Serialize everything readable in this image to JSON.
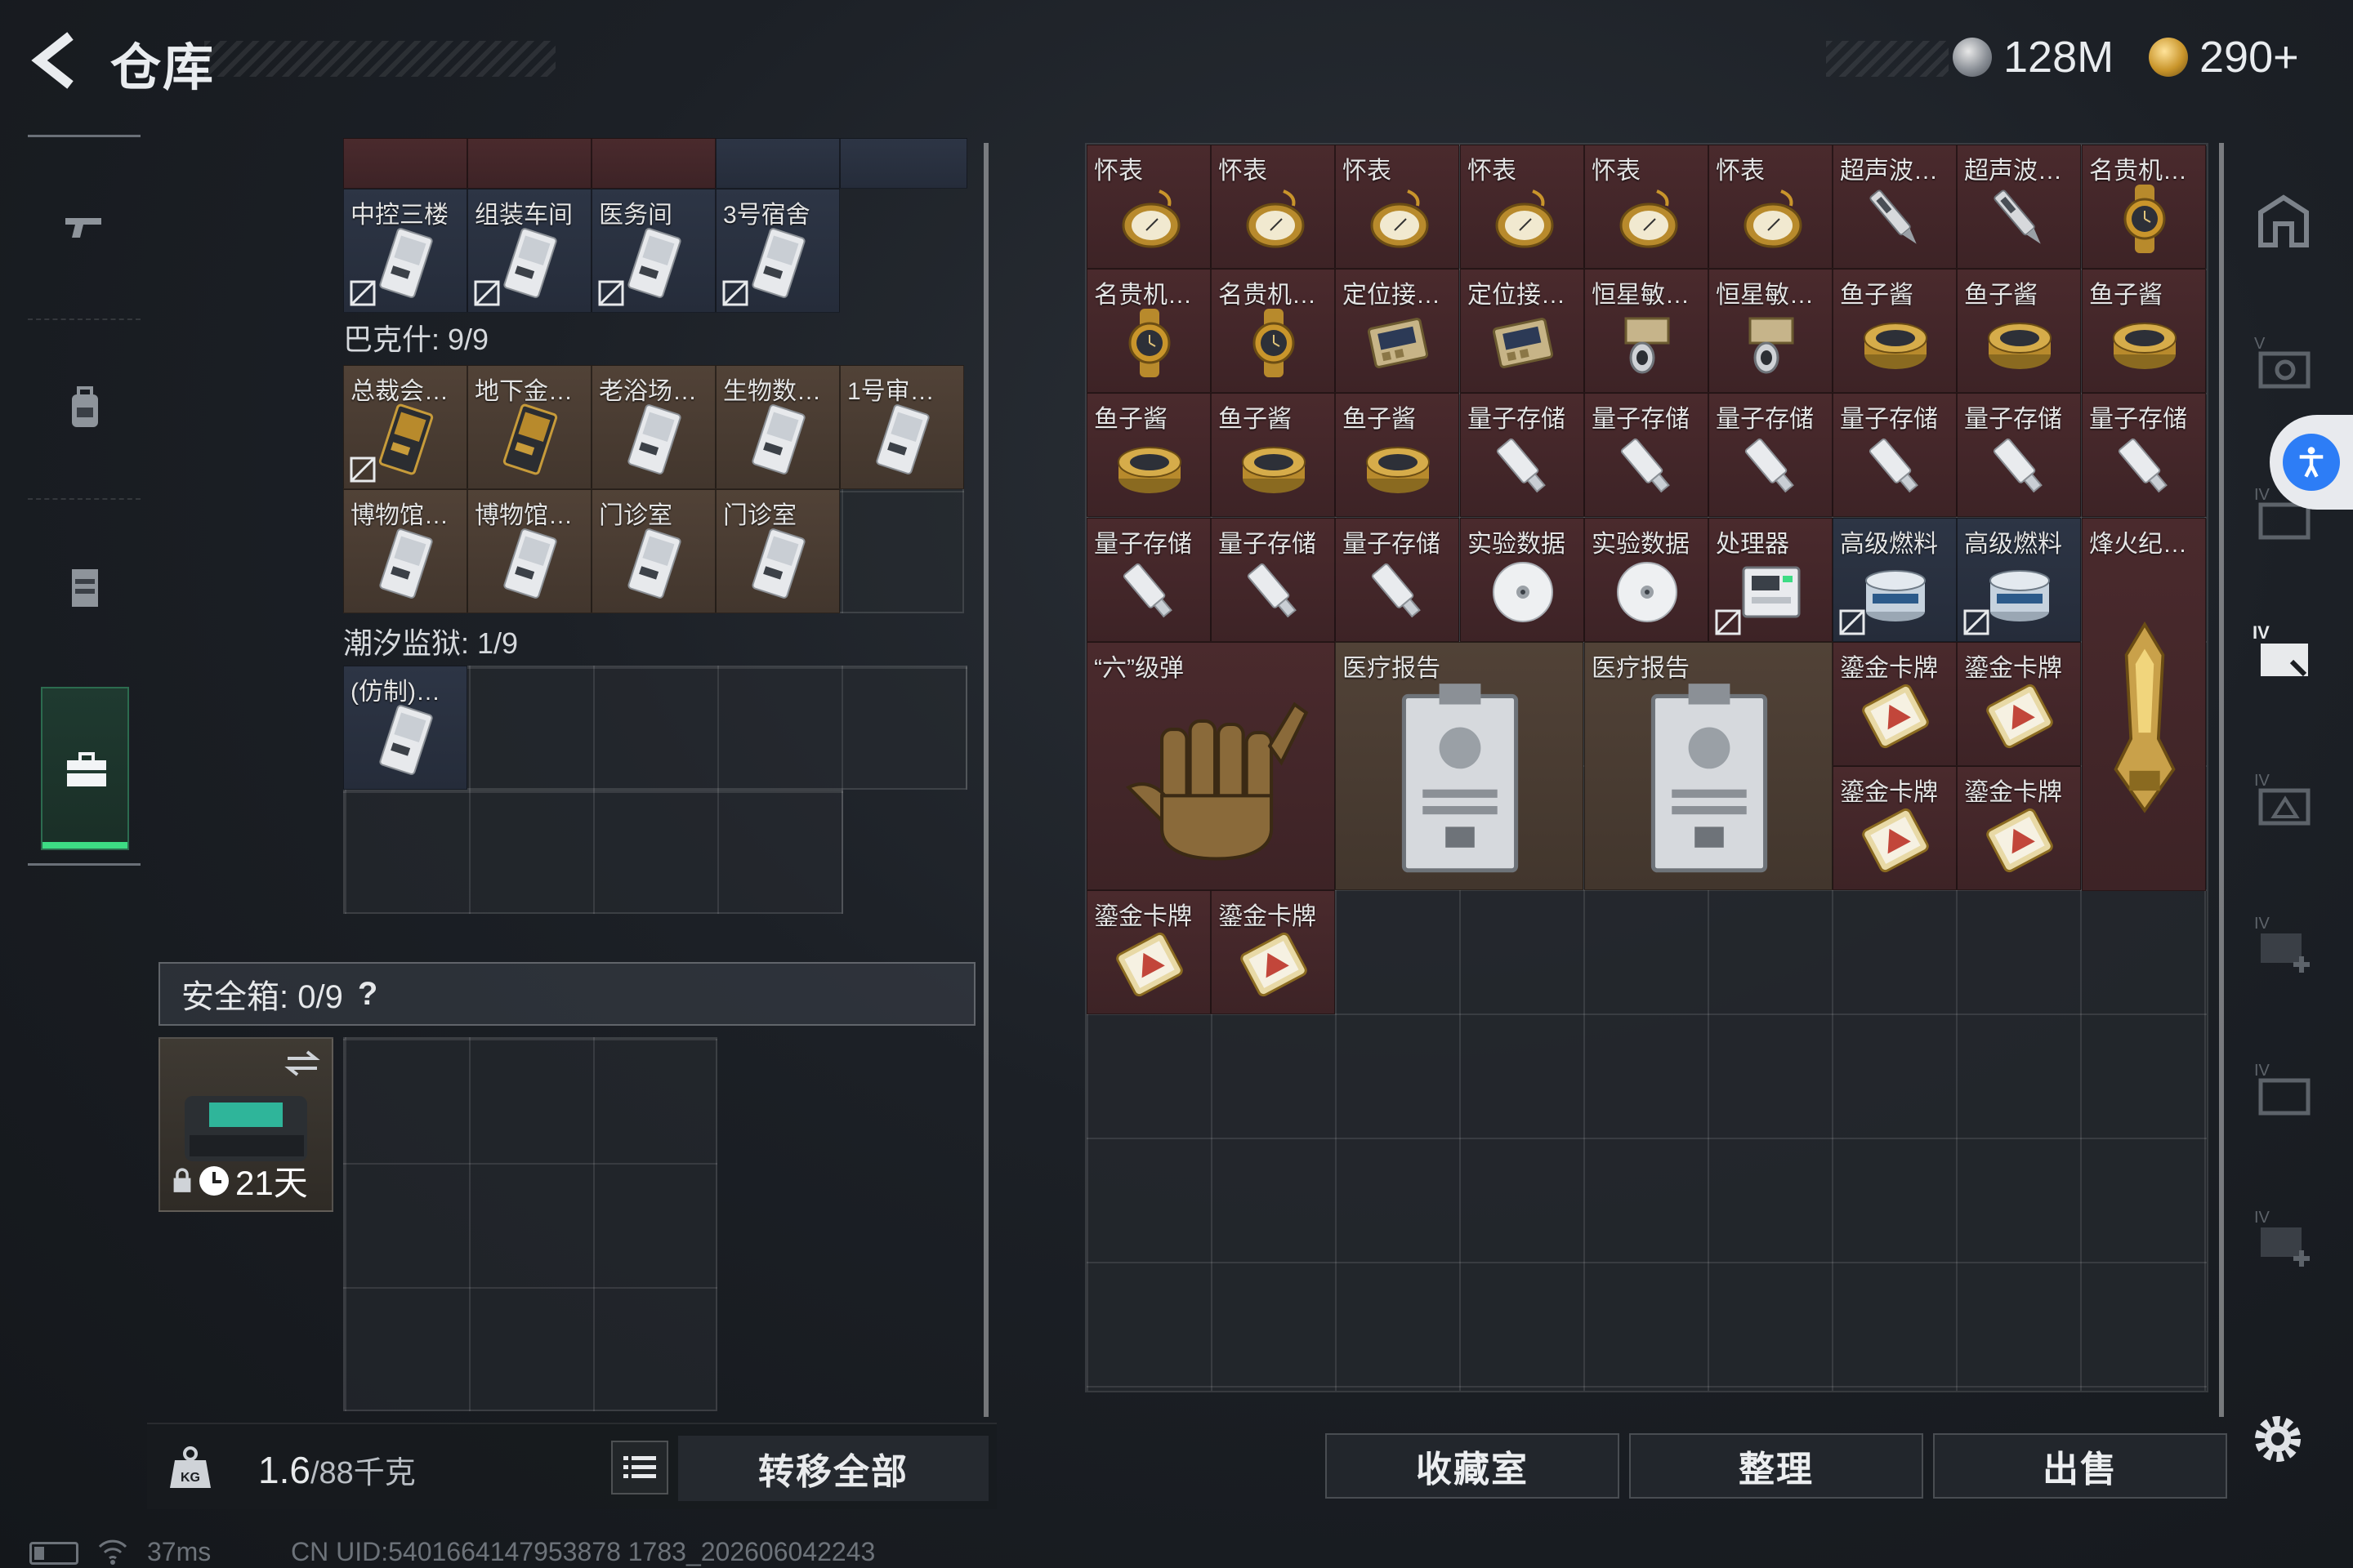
{
  "header": {
    "title": "仓库",
    "currency_1": "128M",
    "currency_2": "290+"
  },
  "left_nav": {
    "items": [
      "gun-icon",
      "backpack-icon",
      "vest-icon",
      "case-icon"
    ],
    "active": 3
  },
  "left_panel": {
    "top_row_labels": [
      "中控三楼",
      "组装车间",
      "医务间",
      "3号宿舍"
    ],
    "section_bakeshi": "巴克什: 9/9",
    "bakeshi_items": [
      "总裁会…",
      "地下金…",
      "老浴场…",
      "生物数…",
      "1号审…",
      "博物馆…",
      "博物馆…",
      "门诊室",
      "门诊室"
    ],
    "section_chaoxi": "潮汐监狱: 1/9",
    "chaoxi_items": [
      "(仿制)…"
    ],
    "safebox_label": "安全箱: 0/9",
    "safebox_help": "?",
    "safebox_days": "21天"
  },
  "bottom_left": {
    "weight_value": "1.6",
    "weight_total": "/88千克",
    "transfer_all": "转移全部"
  },
  "right_panel": {
    "row1": [
      "怀表",
      "怀表",
      "怀表",
      "怀表",
      "怀表",
      "怀表",
      "超声波…",
      "超声波…",
      "名贵机…"
    ],
    "row2": [
      "名贵机…",
      "名贵机…",
      "定位接…",
      "定位接…",
      "恒星敏…",
      "恒星敏…",
      "鱼子酱",
      "鱼子酱",
      "鱼子酱"
    ],
    "row3": [
      "鱼子酱",
      "鱼子酱",
      "鱼子酱",
      "量子存储",
      "量子存储",
      "量子存储",
      "量子存储",
      "量子存储",
      "量子存储"
    ],
    "row4": [
      "量子存储",
      "量子存储",
      "量子存储",
      "实验数据",
      "实验数据",
      "处理器",
      "高级燃料",
      "高级燃料",
      "烽火纪…"
    ],
    "big_items": [
      "“六”级弹",
      "医疗报告",
      "医疗报告"
    ],
    "gold_cards": [
      "鎏金卡牌",
      "鎏金卡牌",
      "鎏金卡牌",
      "鎏金卡牌",
      "鎏金卡牌",
      "鎏金卡牌"
    ]
  },
  "actions": {
    "collection": "收藏室",
    "sort": "整理",
    "sell": "出售"
  },
  "status": {
    "ping": "37ms",
    "uid": "CN UID:5401664147953878 1783_202606042243"
  }
}
